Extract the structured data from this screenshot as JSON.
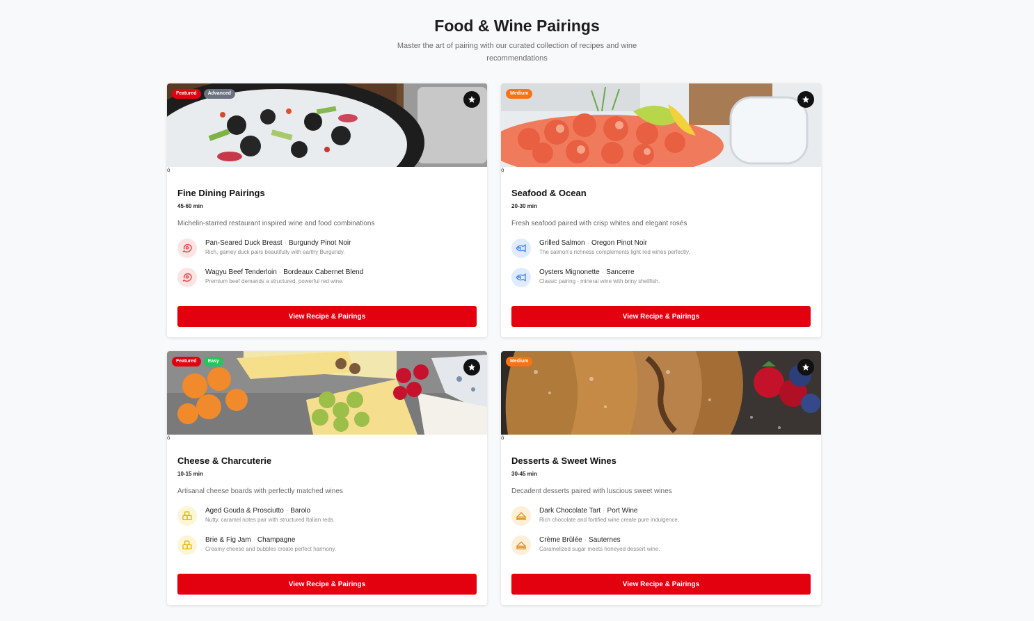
{
  "header": {
    "title": "Food & Wine Pairings",
    "subtitle": "Master the art of pairing with our curated collection of recipes and wine recommendations"
  },
  "cards": [
    {
      "title": "Fine Dining Pairings",
      "time": "45-60 min",
      "description": "Michelin-starred restaurant inspired wine and food combinations",
      "image_alt_text": "ó",
      "badges": [
        {
          "label": "Featured",
          "color": "#e3000f"
        },
        {
          "label": "Advanced",
          "color": "#6b7280"
        }
      ],
      "icon": "steak-icon",
      "icon_color": "#e23b3b",
      "icon_bg": "#fde4e4",
      "pairings": [
        {
          "dish": "Pan-Seared Duck Breast",
          "wine": "Burgundy Pinot Noir",
          "note": "Rich, gamey duck pairs beautifully with earthy Burgundy."
        },
        {
          "dish": "Wagyu Beef Tenderloin",
          "wine": "Bordeaux Cabernet Blend",
          "note": "Premium beef demands a structured, powerful red wine."
        }
      ],
      "cta": "View Recipe & Pairings"
    },
    {
      "title": "Seafood & Ocean",
      "time": "20-30 min",
      "description": "Fresh seafood paired with crisp whites and elegant rosés",
      "image_alt_text": "ó",
      "badges": [
        {
          "label": "Medium",
          "color": "#f97316"
        }
      ],
      "icon": "fish-icon",
      "icon_color": "#3b82f6",
      "icon_bg": "#e0ecfd",
      "pairings": [
        {
          "dish": "Grilled Salmon",
          "wine": "Oregon Pinot Noir",
          "note": "The salmon's richness complements light red wines perfectly."
        },
        {
          "dish": "Oysters Mignonette",
          "wine": "Sancerre",
          "note": "Classic pairing - mineral wine with briny shellfish."
        }
      ],
      "cta": "View Recipe & Pairings"
    },
    {
      "title": "Cheese & Charcuterie",
      "time": "10-15 min",
      "description": "Artisanal cheese boards with perfectly matched wines",
      "image_alt_text": "ó",
      "badges": [
        {
          "label": "Featured",
          "color": "#e3000f"
        },
        {
          "label": "Easy",
          "color": "#22c55e"
        }
      ],
      "icon": "cheese-board-icon",
      "icon_color": "#e5b400",
      "icon_bg": "#fdf6d4",
      "pairings": [
        {
          "dish": "Aged Gouda & Prosciutto",
          "wine": "Barolo",
          "note": "Nutty, caramel notes pair with structured Italian reds."
        },
        {
          "dish": "Brie & Fig Jam",
          "wine": "Champagne",
          "note": "Creamy cheese and bubbles create perfect harmony."
        }
      ],
      "cta": "View Recipe & Pairings"
    },
    {
      "title": "Desserts & Sweet Wines",
      "time": "30-45 min",
      "description": "Decadent desserts paired with luscious sweet wines",
      "image_alt_text": "ó",
      "badges": [
        {
          "label": "Medium",
          "color": "#f97316"
        }
      ],
      "icon": "cake-icon",
      "icon_color": "#e0902a",
      "icon_bg": "#fdefd8",
      "pairings": [
        {
          "dish": "Dark Chocolate Tart",
          "wine": "Port Wine",
          "note": "Rich chocolate and fortified wine create pure indulgence."
        },
        {
          "dish": "Crème Brûlée",
          "wine": "Sauternes",
          "note": "Caramelized sugar meets honeyed dessert wine."
        }
      ],
      "cta": "View Recipe & Pairings"
    }
  ]
}
